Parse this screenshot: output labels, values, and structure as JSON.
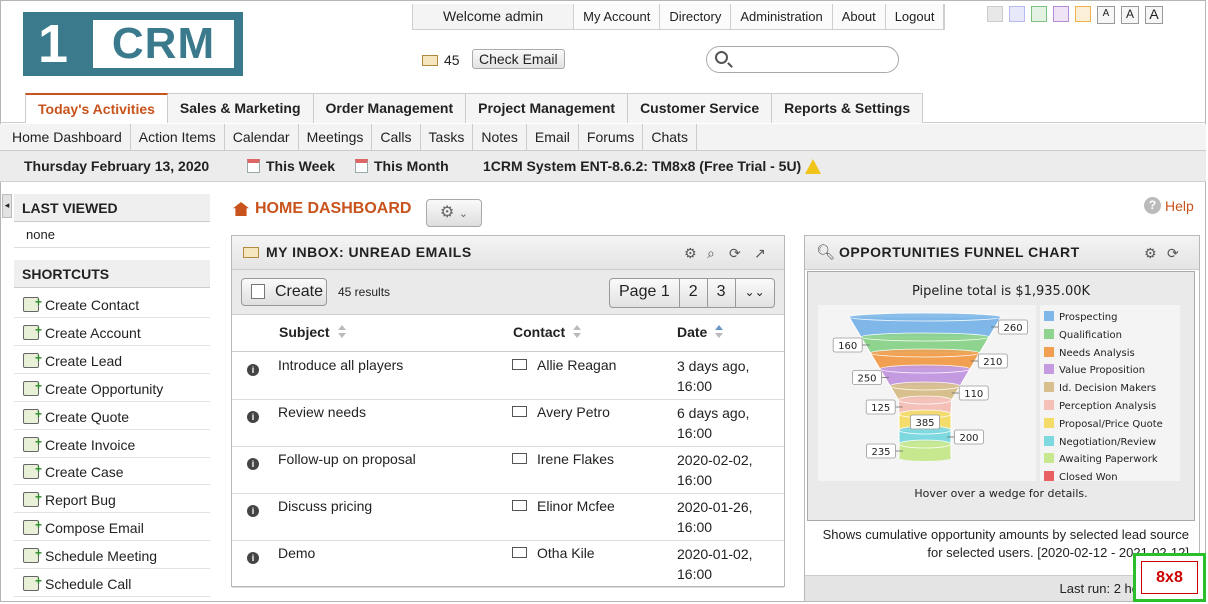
{
  "logo": {
    "one": "1",
    "text": "CRM"
  },
  "top": {
    "welcome": "Welcome admin",
    "links": [
      "My Account",
      "Directory",
      "Administration",
      "About",
      "Logout"
    ],
    "swatch_colors": [
      "#cccccc",
      "#b9b9f0",
      "#7ec07e",
      "#b58ad8",
      "#f0b24a"
    ],
    "font_sizes": [
      "A",
      "A",
      "A"
    ]
  },
  "mail": {
    "count": "45",
    "check_label": "Check Email"
  },
  "search": {
    "placeholder": ""
  },
  "main_tabs": [
    "Today's Activities",
    "Sales & Marketing",
    "Order Management",
    "Project Management",
    "Customer Service",
    "Reports & Settings"
  ],
  "sub_tabs": [
    "Home Dashboard",
    "Action Items",
    "Calendar",
    "Meetings",
    "Calls",
    "Tasks",
    "Notes",
    "Email",
    "Forums",
    "Chats"
  ],
  "datebar": {
    "date": "Thursday February 13, 2020",
    "this_week": "This Week",
    "this_month": "This Month",
    "system": "1CRM System ENT-8.6.2: TM8x8 (Free Trial - 5U)"
  },
  "sidebar": {
    "last_viewed_title": "LAST VIEWED",
    "last_viewed_none": "none",
    "shortcuts_title": "SHORTCUTS",
    "shortcuts": [
      "Create Contact",
      "Create Account",
      "Create Lead",
      "Create Opportunity",
      "Create Quote",
      "Create Invoice",
      "Create Case",
      "Report Bug",
      "Compose Email",
      "Schedule Meeting",
      "Schedule Call"
    ]
  },
  "dashboard": {
    "title": "HOME DASHBOARD",
    "help": "Help"
  },
  "inbox": {
    "title": "MY INBOX: UNREAD EMAILS",
    "create": "Create",
    "results": "45 results",
    "pages": [
      "Page 1",
      "2",
      "3"
    ],
    "columns": [
      "Subject",
      "Contact",
      "Date"
    ],
    "rows": [
      {
        "subject": "Introduce all players",
        "contact": "Allie Reagan",
        "date": "3 days ago, 16:00"
      },
      {
        "subject": "Review needs",
        "contact": "Avery Petro",
        "date": "6 days ago, 16:00"
      },
      {
        "subject": "Follow-up on proposal",
        "contact": "Irene Flakes",
        "date": "2020-02-02, 16:00"
      },
      {
        "subject": "Discuss pricing",
        "contact": "Elinor Mcfee",
        "date": "2020-01-26, 16:00"
      },
      {
        "subject": "Demo",
        "contact": "Otha Kile",
        "date": "2020-01-02, 16:00"
      }
    ]
  },
  "funnel": {
    "title": "OPPORTUNITIES FUNNEL CHART",
    "description": "Shows cumulative opportunity amounts by selected lead source for selected users. [2020-02-12 - 2021-02-12]",
    "last_run": "Last run: 2 ho"
  },
  "chart_data": {
    "type": "funnel",
    "title": "Pipeline total is $1,935.00K",
    "footer": "Hover over a wedge for details.",
    "categories": [
      "Prospecting",
      "Qualification",
      "Needs Analysis",
      "Value Proposition",
      "Id. Decision Makers",
      "Perception Analysis",
      "Proposal/Price Quote",
      "Negotiation/Review",
      "Awaiting Paperwork",
      "Closed Won"
    ],
    "values": [
      260,
      160,
      210,
      250,
      110,
      125,
      385,
      200,
      235,
      0
    ],
    "colors": [
      "#7fb8e8",
      "#8ed48e",
      "#f0a050",
      "#c49ae0",
      "#d8bf8e",
      "#f4c0b8",
      "#f4dc6a",
      "#7ed8e0",
      "#c8e890",
      "#e86060"
    ],
    "legend": "right"
  },
  "badge": {
    "text": "8x8"
  }
}
